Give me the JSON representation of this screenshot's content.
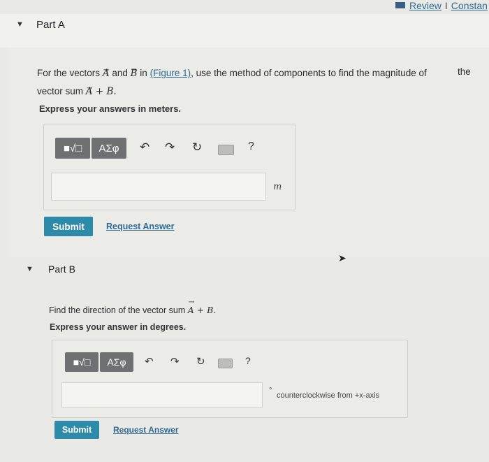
{
  "header": {
    "review_label": "Review",
    "separator": "I",
    "constants_label": "Constan"
  },
  "part_a": {
    "title": "Part A",
    "question_pre": "For the vectors",
    "vec_a": "A",
    "and": "and",
    "vec_b": "B",
    "in": "in",
    "figure_link": "(Figure 1)",
    "question_post": ", use the method of components to find the magnitude of",
    "the_word": "the",
    "line2_pre": "vector sum",
    "sum_expr": "A + B.",
    "instruction": "Express your answers in meters.",
    "toolbar": {
      "templates_label": "■√□",
      "greek_label": "ΑΣφ",
      "help_label": "?"
    },
    "input_value": "",
    "unit": "m",
    "submit_label": "Submit",
    "request_label": "Request Answer"
  },
  "part_b": {
    "title": "Part B",
    "question_pre": "Find the  direction of the vector sum",
    "sum_expr": "A + B.",
    "instruction": "Express your answer in degrees.",
    "toolbar": {
      "templates_label": "■√□",
      "greek_label": "ΑΣφ",
      "help_label": "?"
    },
    "input_value": "",
    "unit_degree": "°",
    "unit_text": "counterclockwise from +x-axis",
    "submit_label": "Submit",
    "request_label": "Request Answer"
  },
  "colors": {
    "accent": "#2d8aa8",
    "link": "#2f6b93",
    "toolbar_btn": "#6f7072"
  }
}
